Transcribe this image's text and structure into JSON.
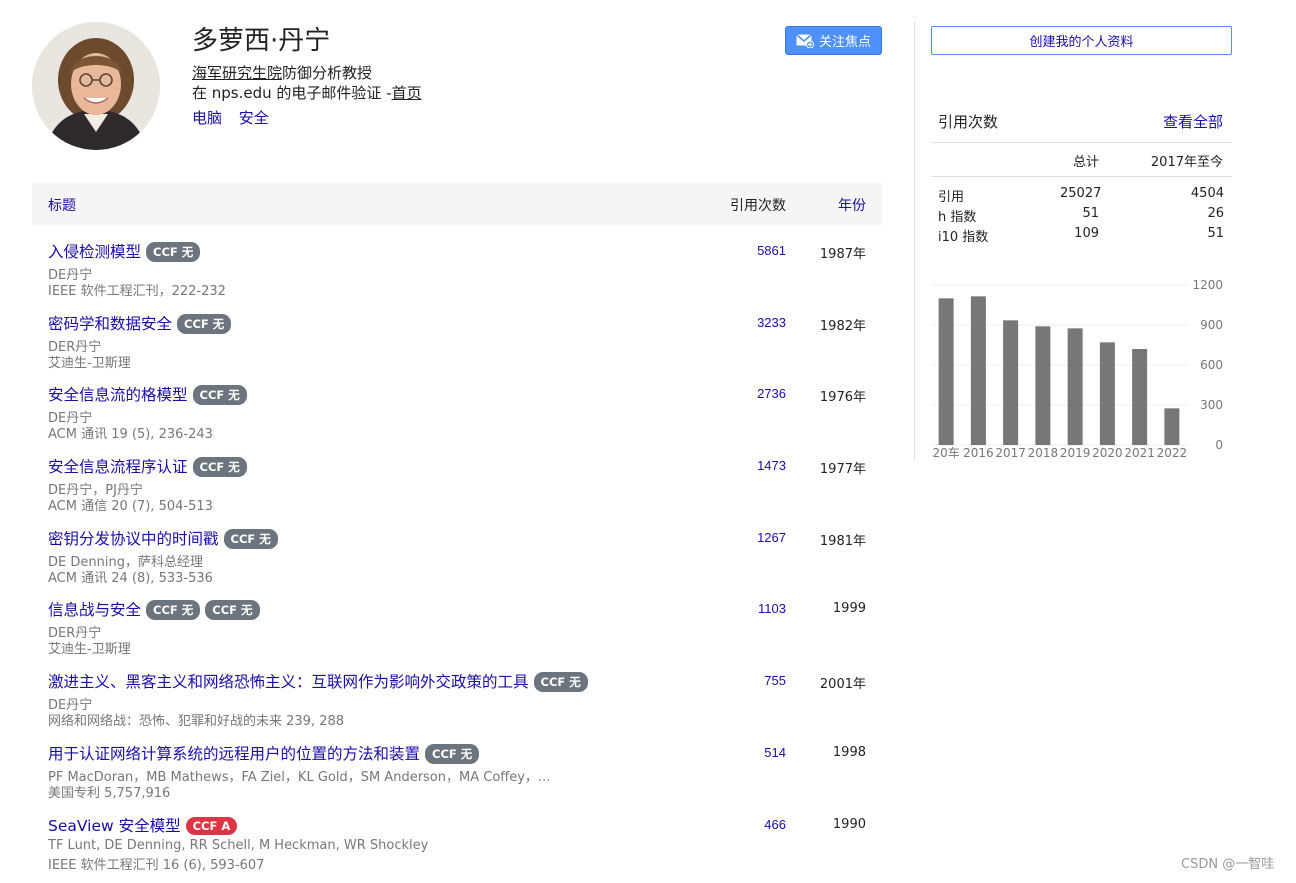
{
  "profile": {
    "name": "多萝西·丹宁",
    "affiliation_link": "海军研究生院",
    "affiliation_rest": "防御分析教授",
    "email_text": "在 nps.edu 的电子邮件验证 -",
    "homepage_label": "首页",
    "interests": [
      "电脑",
      "安全"
    ],
    "follow_label": "关注焦点",
    "create_profile_label": "创建我的个人资料"
  },
  "table": {
    "col_title": "标题",
    "col_cites": "引用次数",
    "col_year": "年份"
  },
  "articles": [
    {
      "title": "入侵检测模型",
      "badges": [
        {
          "text": "CCF 无",
          "color": "#6c757d"
        }
      ],
      "authors": "DE丹宁",
      "venue": "IEEE 软件工程汇刊，222-232",
      "cites": "5861",
      "year": "1987年"
    },
    {
      "title": "密码学和数据安全",
      "badges": [
        {
          "text": "CCF 无",
          "color": "#6c757d"
        }
      ],
      "authors": "DER丹宁",
      "venue": "艾迪生-卫斯理",
      "cites": "3233",
      "year": "1982年"
    },
    {
      "title": "安全信息流的格模型",
      "badges": [
        {
          "text": "CCF 无",
          "color": "#6c757d"
        }
      ],
      "authors": "DE丹宁",
      "venue": "ACM 通讯 19 (5), 236-243",
      "cites": "2736",
      "year": "1976年"
    },
    {
      "title": "安全信息流程序认证",
      "badges": [
        {
          "text": "CCF 无",
          "color": "#6c757d"
        }
      ],
      "authors": "DE丹宁，PJ丹宁",
      "venue": "ACM 通信 20 (7), 504-513",
      "cites": "1473",
      "year": "1977年"
    },
    {
      "title": "密钥分发协议中的时间戳",
      "badges": [
        {
          "text": "CCF 无",
          "color": "#6c757d"
        }
      ],
      "authors": "DE Denning，萨科总经理",
      "venue": "ACM 通讯 24 (8), 533-536",
      "cites": "1267",
      "year": "1981年"
    },
    {
      "title": "信息战与安全",
      "badges": [
        {
          "text": "CCF 无",
          "color": "#6c757d"
        },
        {
          "text": "CCF 无",
          "color": "#6c757d"
        }
      ],
      "authors": "DER丹宁",
      "venue": "艾迪生-卫斯理",
      "cites": "1103",
      "year": "1999"
    },
    {
      "title": "激进主义、黑客主义和网络恐怖主义：互联网作为影响外交政策的工具",
      "badges": [
        {
          "text": "CCF 无",
          "color": "#6c757d"
        }
      ],
      "authors": "DE丹宁",
      "venue": "网络和网络战：恐怖、犯罪和好战的未来 239, 288",
      "cites": "755",
      "year": "2001年"
    },
    {
      "title": "用于认证网络计算系统的远程用户的位置的方法和装置",
      "badges": [
        {
          "text": "CCF 无",
          "color": "#6c757d"
        }
      ],
      "authors": "PF MacDoran，MB Mathews，FA Ziel，KL Gold，SM Anderson，MA Coffey，...",
      "venue": "美国专利 5,757,916",
      "cites": "514",
      "year": "1998"
    },
    {
      "title": "SeaView 安全模型",
      "badges": [
        {
          "text": "CCF A",
          "color": "#dc3545"
        }
      ],
      "authors": "TF Lunt, DE Denning, RR Schell, M Heckman, WR Shockley",
      "venue": "IEEE 软件工程汇刊 16 (6), 593-607",
      "cites": "466",
      "year": "1990"
    }
  ],
  "stats": {
    "heading": "引用次数",
    "view_all": "查看全部",
    "col_total": "总计",
    "col_since": "2017年至今",
    "rows": [
      {
        "label": "引用",
        "total": "25027",
        "since": "4504"
      },
      {
        "label": "h 指数",
        "total": "51",
        "since": "26"
      },
      {
        "label": "i10 指数",
        "total": "109",
        "since": "51"
      }
    ]
  },
  "chart_data": {
    "type": "bar",
    "categories": [
      "2015",
      "2016",
      "2017",
      "2018",
      "2019",
      "2020",
      "2021",
      "2022"
    ],
    "tick_labels": [
      "20车",
      "2016",
      "2017",
      "2018",
      "2019",
      "2020",
      "2021",
      "2022"
    ],
    "values": [
      1100,
      1115,
      935,
      890,
      875,
      770,
      720,
      275
    ],
    "ylim": [
      0,
      1200
    ],
    "yticks": [
      0,
      300,
      600,
      900,
      1200
    ],
    "bar_color": "#777777",
    "grid": true,
    "title": "",
    "xlabel": "",
    "ylabel": ""
  },
  "watermark": "CSDN @一智哇"
}
